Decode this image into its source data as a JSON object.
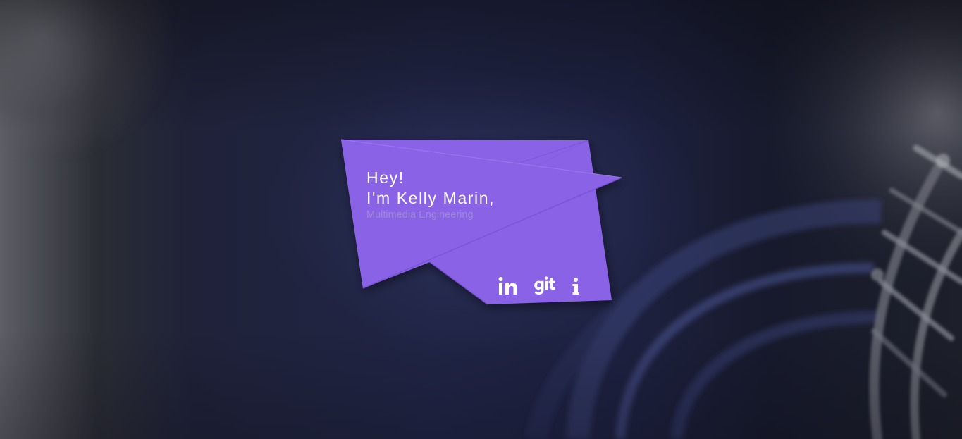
{
  "card": {
    "greeting": "Hey!",
    "name": "I'm Kelly Marin,",
    "role": "Multimedia Engineering"
  },
  "social": [
    {
      "id": "linkedin",
      "label": "in"
    },
    {
      "id": "github",
      "label": "git"
    },
    {
      "id": "info",
      "label": "i"
    }
  ],
  "colors": {
    "card_primary": "#8a62e6",
    "card_shadow": "#7650d4",
    "role_text": "#9b8ad6",
    "background": "#1c2038"
  }
}
